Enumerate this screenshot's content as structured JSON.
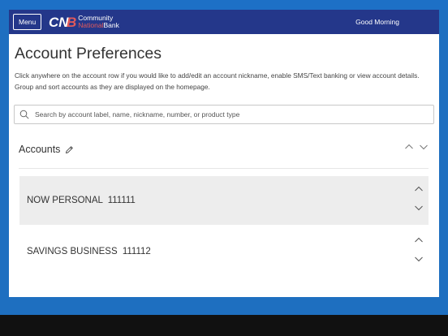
{
  "header": {
    "menu_label": "Menu",
    "logo": {
      "mark": "CNB",
      "line1": "Community",
      "line2_a": "National",
      "line2_b": "Bank"
    },
    "greeting": "Good Morning"
  },
  "page": {
    "title": "Account Preferences",
    "description": "Click anywhere on the account row if you would like to add/edit an account nickname, enable SMS/Text banking or view account details. Group and sort accounts as they are displayed on the homepage."
  },
  "search": {
    "placeholder": "Search by account label, name, nickname, number, or product type",
    "value": ""
  },
  "accounts": {
    "title": "Accounts",
    "items": [
      {
        "name": "NOW PERSONAL",
        "number": "111111"
      },
      {
        "name": "SAVINGS BUSINESS",
        "number": "111112"
      }
    ]
  },
  "colors": {
    "navbar": "#24378a",
    "brand_red": "#e25a5a",
    "frame_blue": "#1d70c6",
    "row_highlight": "#ededed"
  },
  "icons": [
    "search-icon",
    "pencil-icon",
    "chevron-up-icon",
    "chevron-down-icon"
  ]
}
